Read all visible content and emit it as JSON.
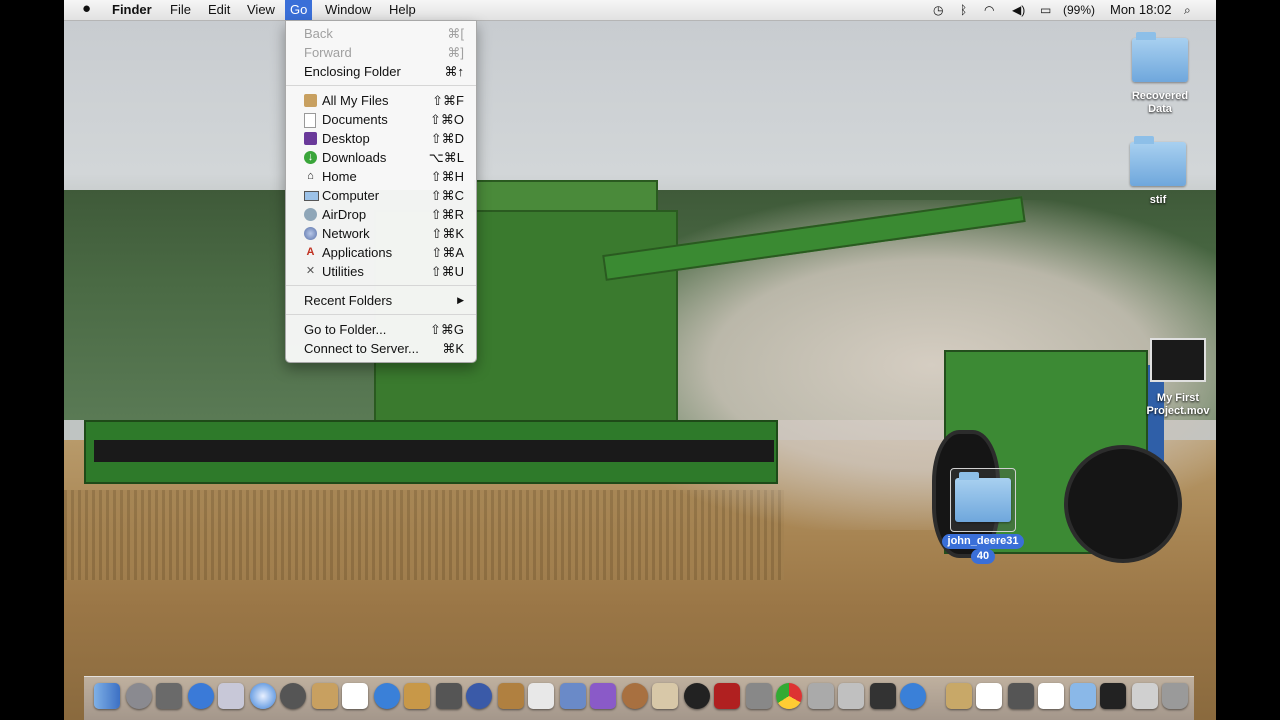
{
  "menubar": {
    "apple_icon": "apple-logo-icon",
    "app": "Finder",
    "items": [
      "File",
      "Edit",
      "View",
      "Go",
      "Window",
      "Help"
    ],
    "battery": "(99%)",
    "clock": "Mon 18:02"
  },
  "go_menu": {
    "back": {
      "label": "Back",
      "shortcut": "⌘["
    },
    "forward": {
      "label": "Forward",
      "shortcut": "⌘]"
    },
    "enclosing": {
      "label": "Enclosing Folder",
      "shortcut": "⌘↑"
    },
    "places": [
      {
        "label": "All My Files",
        "shortcut": "⇧⌘F",
        "icon": "all-files-icon"
      },
      {
        "label": "Documents",
        "shortcut": "⇧⌘O",
        "icon": "documents-icon"
      },
      {
        "label": "Desktop",
        "shortcut": "⇧⌘D",
        "icon": "desktop-icon"
      },
      {
        "label": "Downloads",
        "shortcut": "⌥⌘L",
        "icon": "downloads-icon"
      },
      {
        "label": "Home",
        "shortcut": "⇧⌘H",
        "icon": "home-icon"
      },
      {
        "label": "Computer",
        "shortcut": "⇧⌘C",
        "icon": "computer-icon"
      },
      {
        "label": "AirDrop",
        "shortcut": "⇧⌘R",
        "icon": "airdrop-icon"
      },
      {
        "label": "Network",
        "shortcut": "⇧⌘K",
        "icon": "network-icon"
      },
      {
        "label": "Applications",
        "shortcut": "⇧⌘A",
        "icon": "applications-icon"
      },
      {
        "label": "Utilities",
        "shortcut": "⇧⌘U",
        "icon": "utilities-icon"
      }
    ],
    "recent": {
      "label": "Recent Folders",
      "arrow": "▶"
    },
    "goto": {
      "label": "Go to Folder...",
      "shortcut": "⇧⌘G"
    },
    "connect": {
      "label": "Connect to Server...",
      "shortcut": "⌘K"
    }
  },
  "desktop_icons": {
    "recovered_line1": "Recovered",
    "recovered_line2": "Data",
    "stif": "stif",
    "movie_line1": "My First",
    "movie_line2": "Project.mov",
    "selected_line1": "john_deere31",
    "selected_line2": "40"
  },
  "colors": {
    "menu_highlight": "#3a6fd8",
    "selection_label": "#3a6fd8"
  }
}
